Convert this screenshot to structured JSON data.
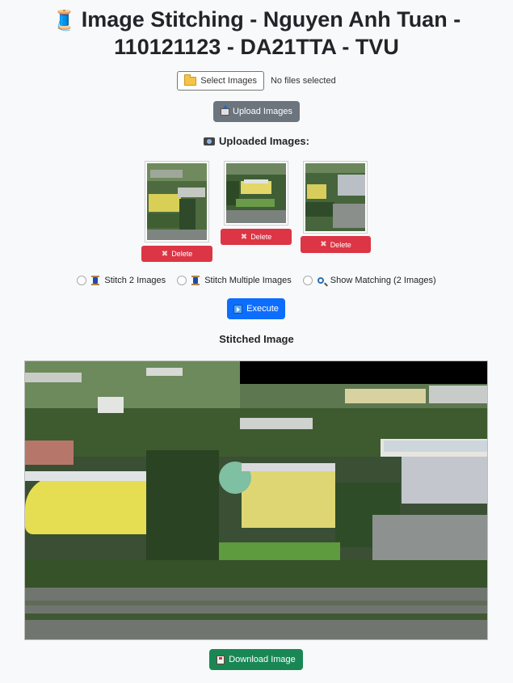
{
  "header": {
    "title_line1": "Image Stitching - Nguyen Anh Tuan -",
    "title_line2": "110121123 - DA21TTA - TVU",
    "title_icon": "spool-of-thread-icon"
  },
  "file_input": {
    "button_label": "Select Images",
    "status": "No files selected"
  },
  "upload": {
    "label": "Upload Images"
  },
  "uploaded": {
    "heading": "Uploaded Images:",
    "items": [
      {
        "delete_label": "Delete"
      },
      {
        "delete_label": "Delete"
      },
      {
        "delete_label": "Delete"
      }
    ]
  },
  "options": {
    "selected": null,
    "items": [
      {
        "label": "Stitch 2 Images",
        "icon": "spool-icon"
      },
      {
        "label": "Stitch Multiple Images",
        "icon": "spool-icon"
      },
      {
        "label": "Show Matching (2 Images)",
        "icon": "magnifier-icon"
      }
    ]
  },
  "execute": {
    "label": "Execute"
  },
  "result": {
    "heading": "Stitched Image"
  },
  "download": {
    "label": "Download Image"
  },
  "colors": {
    "upload_button": "#6c757d",
    "delete_button": "#dc3545",
    "execute_button": "#0d6efd",
    "download_button": "#198754"
  }
}
